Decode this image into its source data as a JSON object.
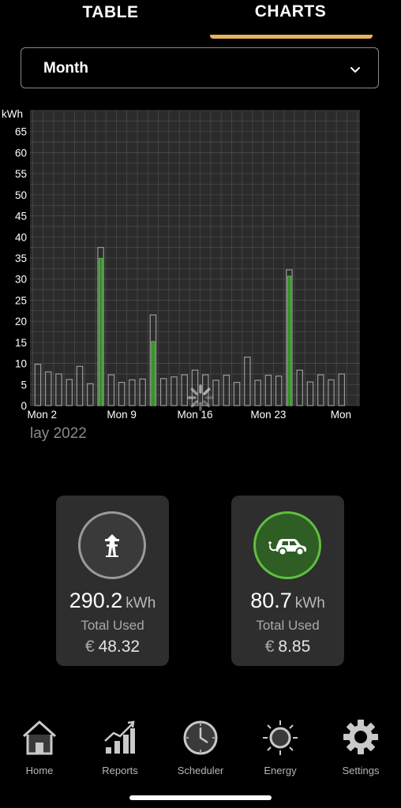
{
  "tabs": [
    {
      "label": "TABLE",
      "active": false
    },
    {
      "label": "CHARTS",
      "active": true
    }
  ],
  "accent_color": "#e8b45a",
  "period_select": {
    "value": "Month"
  },
  "chart_data": {
    "type": "bar",
    "ylabel": "kWh",
    "ylim": [
      0,
      70
    ],
    "yticks": [
      0,
      5,
      10,
      15,
      20,
      25,
      30,
      35,
      40,
      45,
      50,
      55,
      60,
      65
    ],
    "xtick_labels": [
      "Mon 2",
      "Mon 9",
      "Mon 16",
      "Mon 23",
      "Mon"
    ],
    "grid": true,
    "days": [
      1,
      2,
      3,
      4,
      5,
      6,
      7,
      8,
      9,
      10,
      11,
      12,
      13,
      14,
      15,
      16,
      17,
      18,
      19,
      20,
      21,
      22,
      23,
      24,
      25,
      26,
      27,
      28,
      29,
      30,
      31
    ],
    "series": [
      {
        "values": [
          9.8,
          8.0,
          7.5,
          6.2,
          9.3,
          5.2,
          37.5,
          7.3,
          5.5,
          6.1,
          6.3,
          21.5,
          6.4,
          6.8,
          7.3,
          8.4,
          7.3,
          6.0,
          7.2,
          5.5,
          11.5,
          6.0,
          7.2,
          7.0,
          32.2,
          8.4,
          5.6,
          7.3,
          6.1,
          7.5,
          0
        ],
        "color": "#9a9a9a"
      },
      {
        "values": [
          0,
          0,
          0,
          0,
          0,
          0,
          35.0,
          0,
          0,
          0,
          0,
          15.3,
          0,
          0,
          0,
          0,
          0,
          0,
          0,
          0,
          0,
          0,
          0,
          0,
          30.8,
          0,
          0,
          0,
          0,
          0,
          0
        ],
        "color": "#4cbf3a"
      }
    ]
  },
  "month_label": "lay 2022",
  "cards": [
    {
      "icon": "power-pylon-icon",
      "value": "290.2",
      "unit": "kWh",
      "label": "Total Used",
      "currency": "€",
      "cost": "48.32"
    },
    {
      "icon": "electric-car-icon",
      "value": "80.7",
      "unit": "kWh",
      "label": "Total Used",
      "currency": "€",
      "cost": "8.85"
    }
  ],
  "nav": [
    {
      "label": "Home",
      "icon": "home-icon"
    },
    {
      "label": "Reports",
      "icon": "reports-icon"
    },
    {
      "label": "Scheduler",
      "icon": "clock-icon"
    },
    {
      "label": "Energy",
      "icon": "sun-icon"
    },
    {
      "label": "Settings",
      "icon": "gear-icon"
    }
  ]
}
